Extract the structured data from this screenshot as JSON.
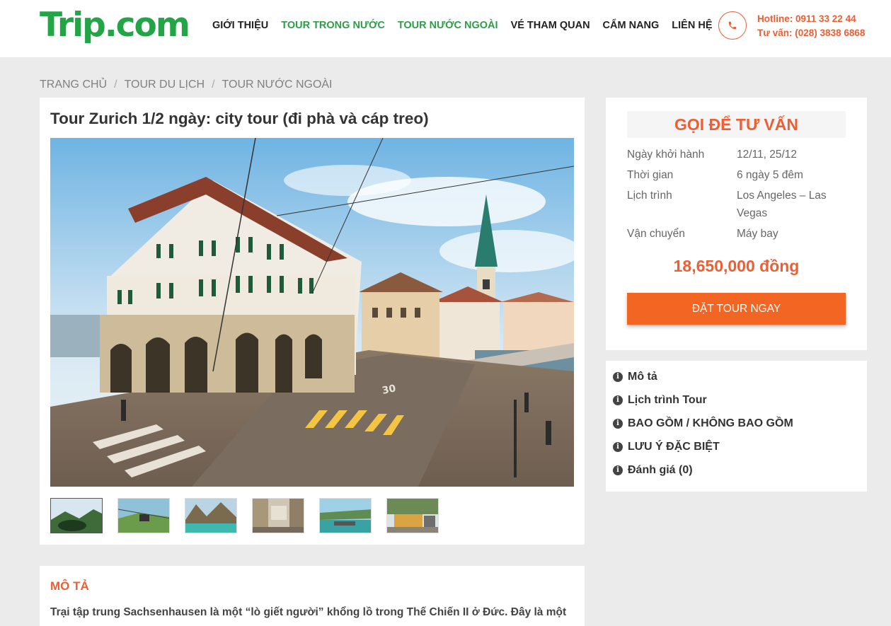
{
  "header": {
    "logo": "Trip.com",
    "nav": [
      {
        "label": "GIỚI THIỆU",
        "color": "#222222"
      },
      {
        "label": "TOUR TRONG NƯỚC",
        "color": "#2d9d48"
      },
      {
        "label": "TOUR NƯỚC NGOÀI",
        "color": "#2d9d48"
      },
      {
        "label": "VÉ THAM QUAN",
        "color": "#222222"
      },
      {
        "label": "CẨM NANG",
        "color": "#222222"
      },
      {
        "label": "LIÊN HỆ",
        "color": "#222222"
      }
    ],
    "hotline": "Hotline: 0911 33 22 44",
    "consult_phone": "Tư vấn: (028) 3838 6868",
    "phone_icon": "phone-icon"
  },
  "breadcrumb": [
    "TRANG CHỦ",
    "TOUR DU LỊCH",
    "TOUR NƯỚC NGOÀI"
  ],
  "tour": {
    "title": "Tour Zurich 1/2 ngày: city tour (đi phà và cáp treo)",
    "description_heading": "MÔ TẢ",
    "description": "Trại tập trung Sachsenhausen là một “lò giết người” khổng lồ trong Thế Chiến II ở Đức. Đây là một"
  },
  "sidebar": {
    "heading": "GỌI ĐỂ TƯ VẤN",
    "details": [
      {
        "label": "Ngày khởi hành",
        "value": "12/11, 25/12"
      },
      {
        "label": "Thời gian",
        "value": "6 ngày 5 đêm"
      },
      {
        "label": "Lịch trình",
        "value": "Los Angeles – Las Vegas"
      },
      {
        "label": "Vận chuyển",
        "value": "Máy bay"
      }
    ],
    "price": "18,650,000 đồng",
    "book_button": "ĐẶT TOUR NGAY",
    "menu": [
      {
        "label": "Mô tả",
        "icon": "info-icon"
      },
      {
        "label": "Lịch trình Tour",
        "icon": "info-icon"
      },
      {
        "label": "BAO GỒM / KHÔNG BAO GỒM",
        "icon": "info-icon"
      },
      {
        "label": "LƯU Ý ĐẶC BIỆT",
        "icon": "info-icon"
      },
      {
        "label": "Đánh giá (0)",
        "icon": "info-icon"
      }
    ]
  },
  "colors": {
    "brand_green": "#22a447",
    "accent_orange": "#ec5f35",
    "button_orange": "#f26522"
  }
}
